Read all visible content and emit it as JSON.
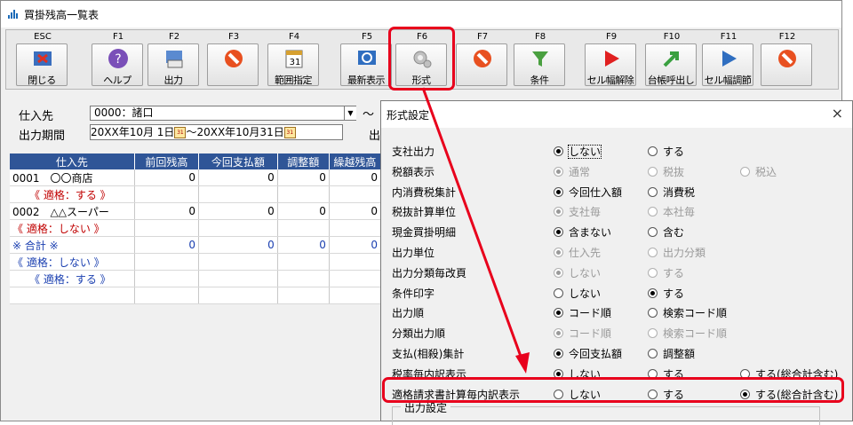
{
  "window": {
    "title": "買掛残高一覧表"
  },
  "toolbar": {
    "keys": [
      {
        "key": "ESC",
        "caption": "閉じる"
      },
      {
        "key": "F1",
        "caption": "ヘルプ"
      },
      {
        "key": "F2",
        "caption": "出力"
      },
      {
        "key": "F3",
        "caption": ""
      },
      {
        "key": "F4",
        "caption": "範囲指定"
      },
      {
        "key": "F5",
        "caption": "最新表示"
      },
      {
        "key": "F6",
        "caption": "形式"
      },
      {
        "key": "F7",
        "caption": ""
      },
      {
        "key": "F8",
        "caption": "条件"
      },
      {
        "key": "F9",
        "caption": "セル幅解除"
      },
      {
        "key": "F10",
        "caption": "台帳呼出し"
      },
      {
        "key": "F11",
        "caption": "セル幅調節"
      },
      {
        "key": "F12",
        "caption": ""
      }
    ]
  },
  "form": {
    "supplier_label": "仕入先",
    "supplier_value": "0000：諸口",
    "tilde": "～",
    "period_label": "出力期間",
    "period_from": "20XX年10月 1日",
    "period_sep": "～",
    "period_to": "20XX年10月31日",
    "side_label": "出"
  },
  "table": {
    "columns": [
      "仕入先",
      "前回残高",
      "今回支払額",
      "調整額",
      "繰越残高"
    ],
    "rows": [
      {
        "cells": [
          "0001　〇〇商店",
          "0",
          "0",
          "0",
          "0"
        ],
        "style": ""
      },
      {
        "cells": [
          "《 適格：する 》",
          "",
          "",
          "",
          ""
        ],
        "style": "red-center"
      },
      {
        "cells": [
          "0002　△△スーパー",
          "0",
          "0",
          "0",
          "0"
        ],
        "style": ""
      },
      {
        "cells": [
          "《 適格：しない 》",
          "",
          "",
          "",
          ""
        ],
        "style": "red"
      },
      {
        "cells": [
          "※ 合計 ※",
          "0",
          "0",
          "0",
          "0"
        ],
        "style": "blue"
      },
      {
        "cells": [
          "《 適格：しない 》",
          "",
          "",
          "",
          ""
        ],
        "style": "blue"
      },
      {
        "cells": [
          "《 適格：する 》",
          "",
          "",
          "",
          ""
        ],
        "style": "blue-center"
      },
      {
        "cells": [
          "",
          "",
          "",
          "",
          ""
        ],
        "style": ""
      }
    ]
  },
  "dialog": {
    "title": "形式設定",
    "close": "×",
    "settings": [
      {
        "label": "支社出力",
        "options": [
          "しない",
          "する"
        ],
        "selected": 0,
        "disabled": false,
        "focus": 0
      },
      {
        "label": "税額表示",
        "options": [
          "通常",
          "税抜",
          "税込"
        ],
        "selected": 0,
        "disabled": true
      },
      {
        "label": "内消費税集計",
        "options": [
          "今回仕入額",
          "消費税"
        ],
        "selected": 0,
        "disabled": false
      },
      {
        "label": "税抜計算単位",
        "options": [
          "支社毎",
          "本社毎"
        ],
        "selected": 0,
        "disabled": true
      },
      {
        "label": "現金買掛明細",
        "options": [
          "含まない",
          "含む"
        ],
        "selected": 0,
        "disabled": false
      },
      {
        "label": "出力単位",
        "options": [
          "仕入先",
          "出力分類"
        ],
        "selected": 0,
        "disabled": true
      },
      {
        "label": "出力分類毎改頁",
        "options": [
          "しない",
          "する"
        ],
        "selected": 0,
        "disabled": true
      },
      {
        "label": "条件印字",
        "options": [
          "しない",
          "する"
        ],
        "selected": 1,
        "disabled": false
      },
      {
        "label": "出力順",
        "options": [
          "コード順",
          "検索コード順"
        ],
        "selected": 0,
        "disabled": false
      },
      {
        "label": "分類出力順",
        "options": [
          "コード順",
          "検索コード順"
        ],
        "selected": 0,
        "disabled": true
      },
      {
        "label": "支払(相殺)集計",
        "options": [
          "今回支払額",
          "調整額"
        ],
        "selected": 0,
        "disabled": false
      },
      {
        "label": "税率毎内訳表示",
        "options": [
          "しない",
          "する",
          "する(総合計含む)"
        ],
        "selected": 0,
        "disabled": false
      },
      {
        "label": "適格請求書計算毎内訳表示",
        "options": [
          "しない",
          "する",
          "する(総合計含む)"
        ],
        "selected": 2,
        "disabled": false
      }
    ],
    "output_group": "出力設定"
  },
  "colors": {
    "highlight": "#e8001c",
    "header": "#2f5597"
  }
}
